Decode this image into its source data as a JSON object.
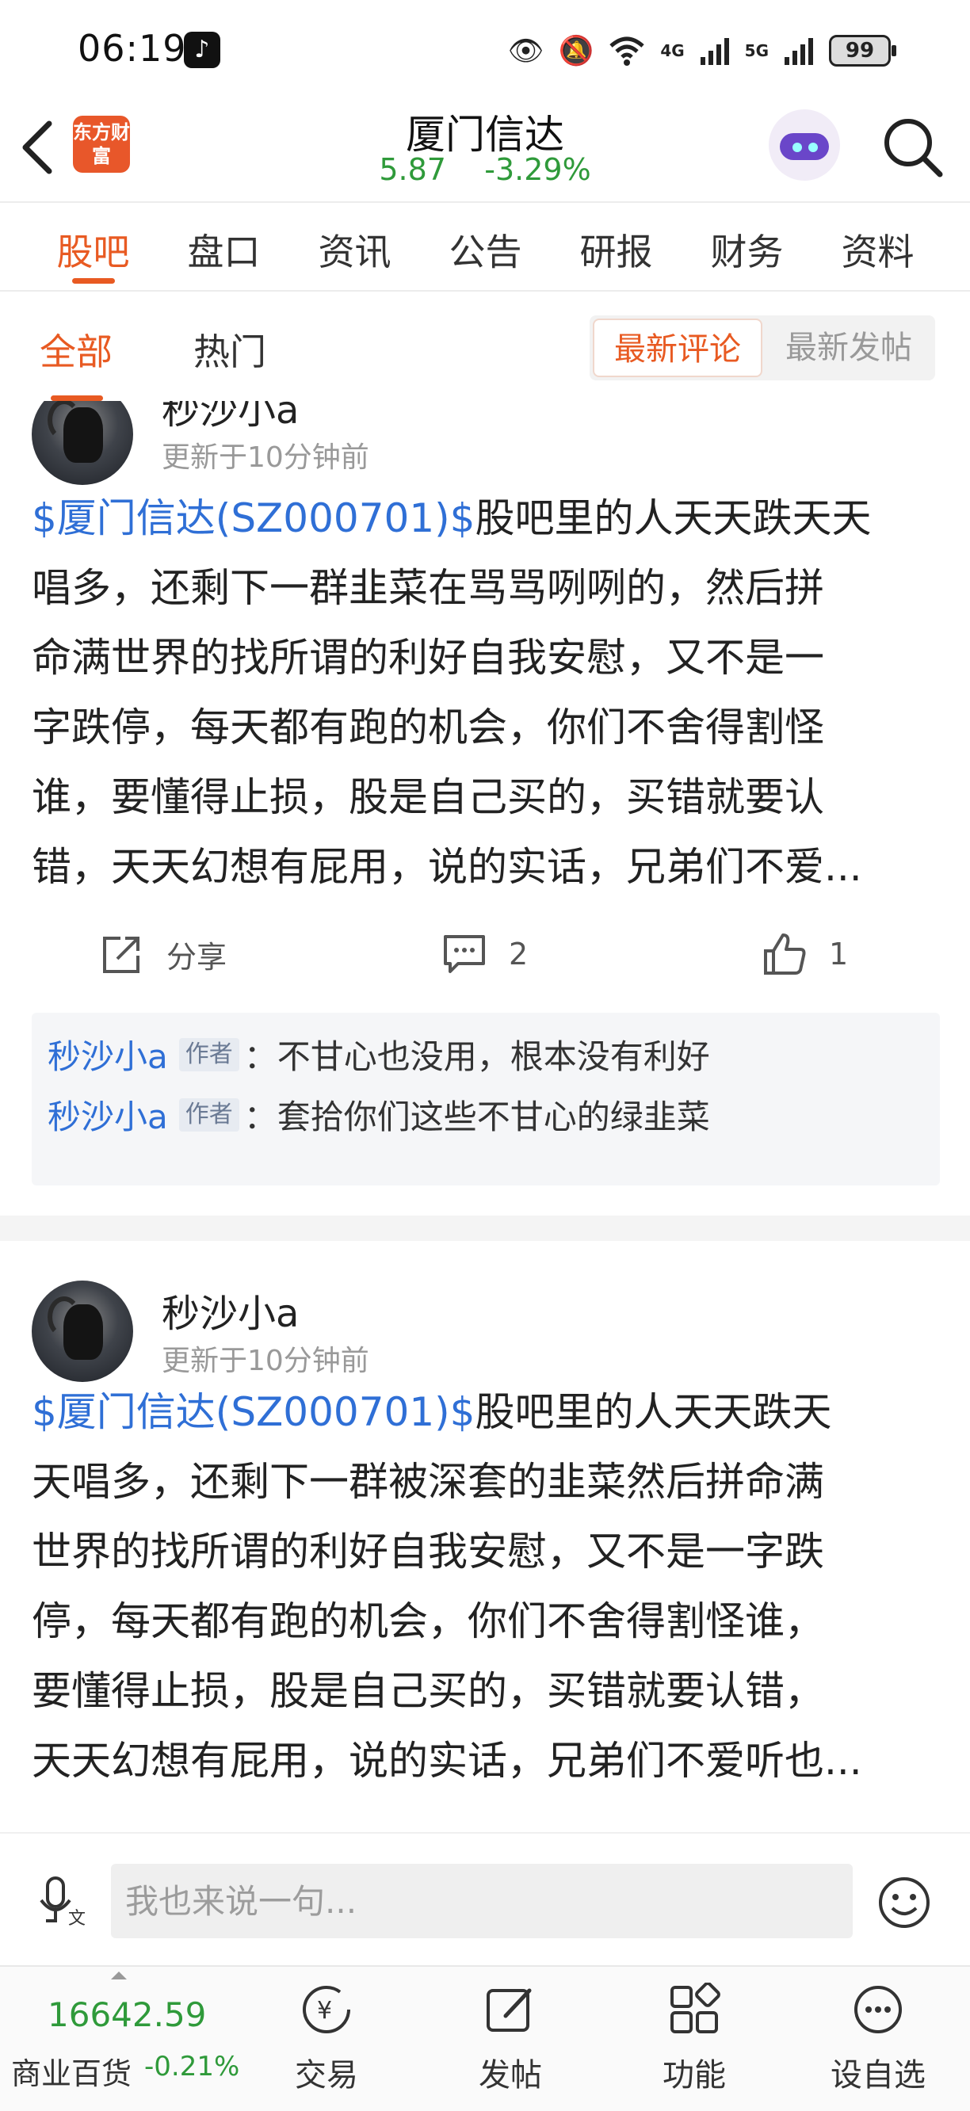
{
  "status_bar": {
    "time": "06:19",
    "network_4g": "4G",
    "network_5g": "5G",
    "battery": "99"
  },
  "header": {
    "brand_logo_text": "东方财富",
    "stock_name": "厦门信达",
    "stock_price": "5.87",
    "stock_change": "-3.29%"
  },
  "main_tabs": [
    {
      "label": "股吧",
      "active": true
    },
    {
      "label": "盘口"
    },
    {
      "label": "资讯"
    },
    {
      "label": "公告"
    },
    {
      "label": "研报"
    },
    {
      "label": "财务"
    },
    {
      "label": "资料"
    }
  ],
  "sub_tabs": {
    "all": "全部",
    "hot": "热门",
    "sort_latest_comment": "最新评论",
    "sort_latest_post": "最新发帖"
  },
  "posts": [
    {
      "user": "秒沙小a",
      "time": "更新于10分钟前",
      "tag": "$厦门信达(SZ000701)$",
      "lines": [
        "股吧里的人天天跌天天",
        "唱多，还剩下一群韭菜在骂骂咧咧的，然后拼",
        "命满世界的找所谓的利好自我安慰，又不是一",
        "字跌停，每天都有跑的机会，你们不舍得割怪",
        "谁，要懂得止损，股是自己买的，买错就要认",
        "错，天天幻想有屁用，说的实话，兄弟们不爱..."
      ],
      "share_label": "分享",
      "comment_count": "2",
      "like_count": "1",
      "comments": [
        {
          "user": "秒沙小a",
          "badge": "作者",
          "text": "：不甘心也没用，根本没有利好"
        },
        {
          "user": "秒沙小a",
          "badge": "作者",
          "text": "：套拾你们这些不甘心的绿韭菜"
        }
      ]
    },
    {
      "user": "秒沙小a",
      "time": "更新于10分钟前",
      "tag": "$厦门信达(SZ000701)$",
      "lines": [
        "股吧里的人天天跌天",
        "天唱多，还剩下一群被深套的韭菜然后拼命满",
        "世界的找所谓的利好自我安慰，又不是一字跌",
        "停，每天都有跑的机会，你们不舍得割怪谁，",
        "要懂得止损，股是自己买的，买错就要认错，",
        "天天幻想有屁用，说的实话，兄弟们不爱听也..."
      ]
    }
  ],
  "comment_input": {
    "placeholder": "我也来说一句..."
  },
  "bottom_nav": {
    "index_value": "16642.59",
    "index_name": "商业百货",
    "index_change": "-0.21%",
    "items": [
      "交易",
      "发帖",
      "功能",
      "设自选"
    ]
  },
  "colors": {
    "accent": "#e85a22",
    "fall_green": "#2f9a3a",
    "link_blue": "#2f6fd6"
  },
  "icons": [
    "back-icon",
    "search-icon",
    "share-icon",
    "comment-icon",
    "like-icon",
    "voice-icon",
    "emoji-icon",
    "trade-icon",
    "post-icon",
    "function-icon",
    "watchlist-icon"
  ]
}
